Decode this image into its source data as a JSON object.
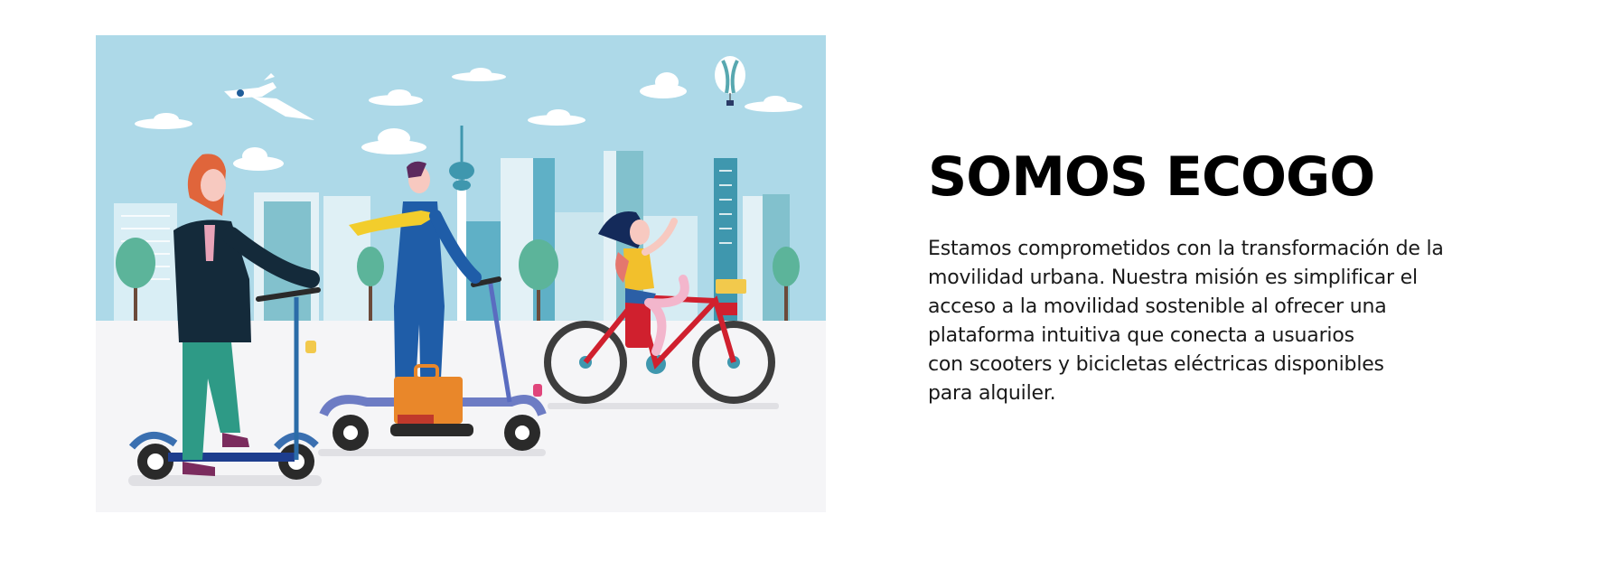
{
  "hero": {
    "illustration": {
      "alt_icon": "city-eco-mobility-illustration",
      "sky_color": "#add9e8",
      "ground_color": "#f5f5f7"
    },
    "title": "SOMOS ECOGO",
    "body_lines": [
      "Estamos comprometidos con la transformación de la",
      "movilidad urbana. Nuestra misión es simplificar el",
      "acceso a la movilidad sostenible al ofrecer una",
      "plataforma intuitiva que conecta a usuarios",
      "con scooters y bicicletas eléctricas disponibles",
      "para alquiler."
    ]
  }
}
